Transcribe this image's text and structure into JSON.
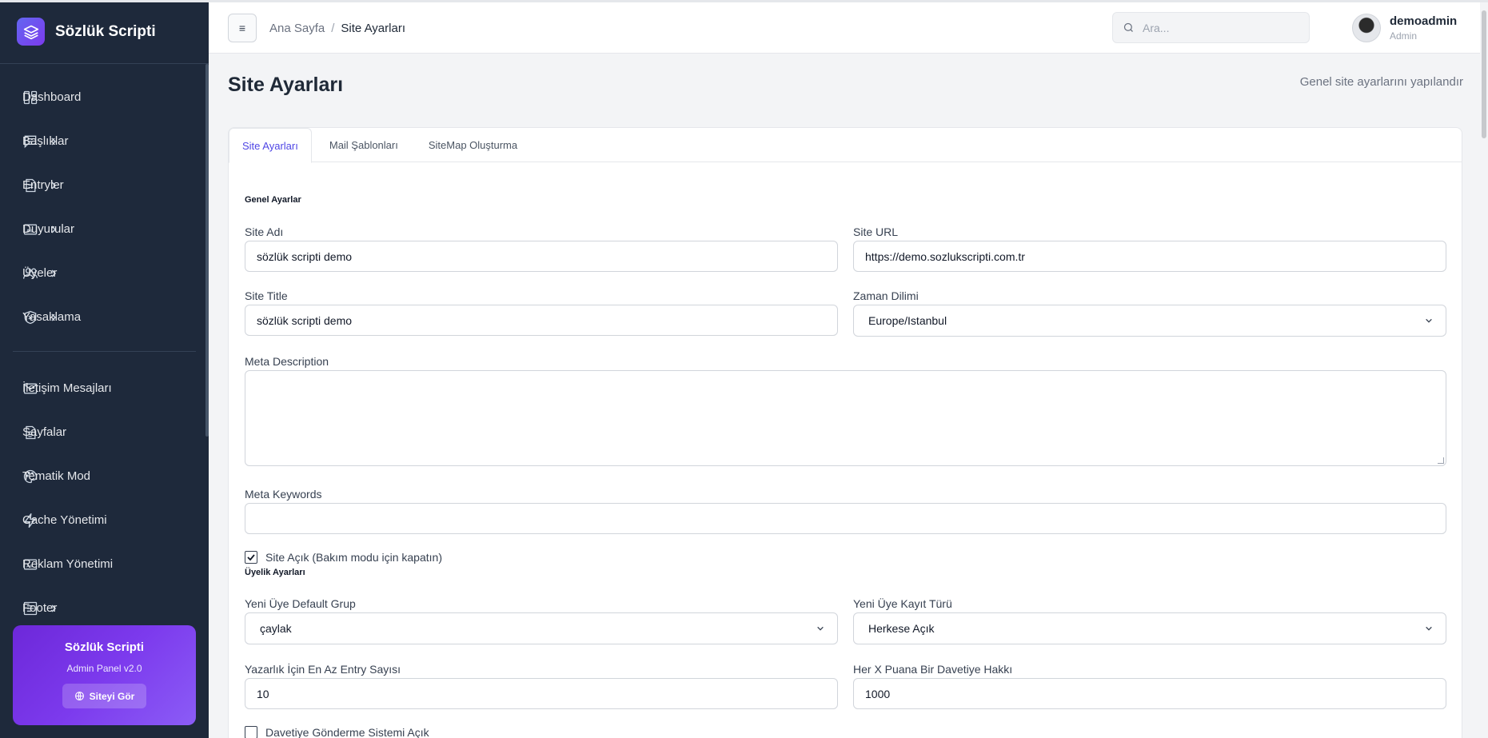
{
  "brand": {
    "title": "Sözlük Scripti",
    "logo_icon": "layers-icon"
  },
  "sidebar": {
    "items": [
      {
        "label": "Dashboard",
        "icon": "dashboard-icon",
        "has_submenu": false
      },
      {
        "label": "Başlıklar",
        "icon": "message-square-icon",
        "has_submenu": true
      },
      {
        "label": "Entryler",
        "icon": "file-text-icon",
        "has_submenu": true
      },
      {
        "label": "Duyurular",
        "icon": "ad-icon",
        "has_submenu": true
      },
      {
        "label": "Üyeler",
        "icon": "users-icon",
        "has_submenu": true
      },
      {
        "label": "Yasaklama",
        "icon": "shield-x-icon",
        "has_submenu": true
      }
    ],
    "items2": [
      {
        "label": "İletişim Mesajları",
        "icon": "mail-icon",
        "has_submenu": false
      },
      {
        "label": "Sayfalar",
        "icon": "file-icon",
        "has_submenu": false
      },
      {
        "label": "Tematik Mod",
        "icon": "palette-icon",
        "has_submenu": false
      },
      {
        "label": "Cache Yönetimi",
        "icon": "zap-icon",
        "has_submenu": false
      },
      {
        "label": "Reklam Yönetimi",
        "icon": "ad-icon",
        "has_submenu": false
      },
      {
        "label": "Footer",
        "icon": "footer-icon",
        "has_submenu": true
      }
    ],
    "promo": {
      "title": "Sözlük Scripti",
      "subtitle": "Admin Panel v2.0",
      "button": "Siteyi Gör"
    }
  },
  "header": {
    "menu_glyph": "≡",
    "breadcrumb": {
      "home": "Ana Sayfa",
      "separator": "/",
      "current": "Site Ayarları"
    },
    "search_placeholder": "Ara...",
    "user": {
      "name": "demoadmin",
      "role": "Admin"
    }
  },
  "page": {
    "title": "Site Ayarları",
    "subtitle": "Genel site ayarlarını yapılandır",
    "tabs": [
      {
        "label": "Site Ayarları",
        "active": true
      },
      {
        "label": "Mail Şablonları",
        "active": false
      },
      {
        "label": "SiteMap Oluşturma",
        "active": false
      }
    ]
  },
  "form": {
    "general_title": "Genel Ayarlar",
    "site_name": {
      "label": "Site Adı",
      "value": "sözlük scripti demo"
    },
    "site_url": {
      "label": "Site URL",
      "value": "https://demo.sozlukscripti.com.tr"
    },
    "site_title": {
      "label": "Site Title",
      "value": "sözlük scripti demo"
    },
    "timezone": {
      "label": "Zaman Dilimi",
      "value": "Europe/Istanbul"
    },
    "meta_description": {
      "label": "Meta Description",
      "value": ""
    },
    "meta_keywords": {
      "label": "Meta Keywords",
      "value": ""
    },
    "site_open": {
      "label": "Site Açık (Bakım modu için kapatın)",
      "checked": true
    },
    "membership_title": "Üyelik Ayarları",
    "default_group": {
      "label": "Yeni Üye Default Grup",
      "value": "çaylak"
    },
    "registration_type": {
      "label": "Yeni Üye Kayıt Türü",
      "value": "Herkese Açık"
    },
    "min_entry": {
      "label": "Yazarlık İçin En Az Entry Sayısı",
      "value": "10"
    },
    "invite_points": {
      "label": "Her X Puana Bir Davetiye Hakkı",
      "value": "1000"
    },
    "invite_system": {
      "label": "Davetiye Gönderme Sistemi Açık",
      "checked": false
    }
  },
  "colors": {
    "sidebar_bg": "#1e293b",
    "accent": "#4f46e5",
    "promo": "#7c3aed"
  }
}
